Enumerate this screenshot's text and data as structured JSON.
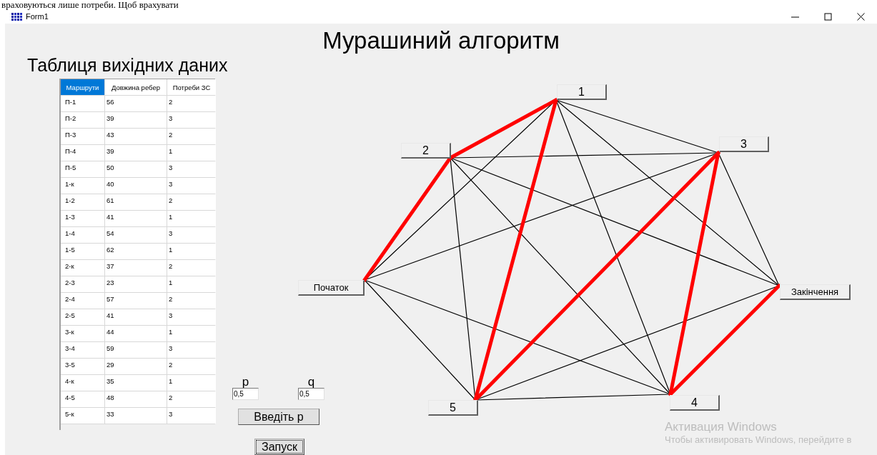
{
  "background_document": {
    "text": "враховуються лише потреби. Щоб врахувати"
  },
  "window": {
    "title": "Form1"
  },
  "heading": "Мурашиний алгоритм",
  "table_title": "Таблиця вихідних даних",
  "table": {
    "columns": [
      {
        "label": "Маршрути",
        "selected": true
      },
      {
        "label": "Довжина ребер",
        "selected": false
      },
      {
        "label": "Потреби ЗС",
        "selected": false
      }
    ],
    "rows": [
      [
        "П-1",
        "56",
        "2"
      ],
      [
        "П-2",
        "39",
        "3"
      ],
      [
        "П-3",
        "43",
        "2"
      ],
      [
        "П-4",
        "39",
        "1"
      ],
      [
        "П-5",
        "50",
        "3"
      ],
      [
        "1-к",
        "40",
        "3"
      ],
      [
        "1-2",
        "61",
        "2"
      ],
      [
        "1-3",
        "41",
        "1"
      ],
      [
        "1-4",
        "54",
        "3"
      ],
      [
        "1-5",
        "62",
        "1"
      ],
      [
        "2-к",
        "37",
        "2"
      ],
      [
        "2-3",
        "23",
        "1"
      ],
      [
        "2-4",
        "57",
        "2"
      ],
      [
        "2-5",
        "41",
        "3"
      ],
      [
        "3-к",
        "44",
        "1"
      ],
      [
        "3-4",
        "59",
        "3"
      ],
      [
        "3-5",
        "29",
        "2"
      ],
      [
        "4-к",
        "35",
        "1"
      ],
      [
        "4-5",
        "48",
        "2"
      ],
      [
        "5-к",
        "33",
        "3"
      ]
    ]
  },
  "params": [
    {
      "label": "p",
      "value": "0,5"
    },
    {
      "label": "q",
      "value": "0,5"
    }
  ],
  "buttons": [
    {
      "label": "Введіть p",
      "focused": false
    },
    {
      "label": "Запуск",
      "focused": true
    }
  ],
  "graph": {
    "nodes": [
      {
        "label": "1"
      },
      {
        "label": "2"
      },
      {
        "label": "3"
      },
      {
        "label": "Початок"
      },
      {
        "label": "Закінчення"
      },
      {
        "label": "5"
      },
      {
        "label": "4"
      }
    ],
    "edges": [
      {
        "highlighted": true
      },
      {
        "highlighted": false
      },
      {
        "highlighted": false
      },
      {
        "highlighted": false
      },
      {
        "highlighted": true
      },
      {
        "highlighted": false
      },
      {
        "highlighted": false
      },
      {
        "highlighted": true
      },
      {
        "highlighted": false
      },
      {
        "highlighted": false
      },
      {
        "highlighted": false
      },
      {
        "highlighted": false
      },
      {
        "highlighted": false
      },
      {
        "highlighted": true
      },
      {
        "highlighted": true
      },
      {
        "highlighted": false
      },
      {
        "highlighted": false
      },
      {
        "highlighted": false
      },
      {
        "highlighted": true
      },
      {
        "highlighted": false
      }
    ]
  },
  "activation_notice": {
    "title": "Активация Windows",
    "text": "Чтобы активировать Windows, перейдите в"
  }
}
